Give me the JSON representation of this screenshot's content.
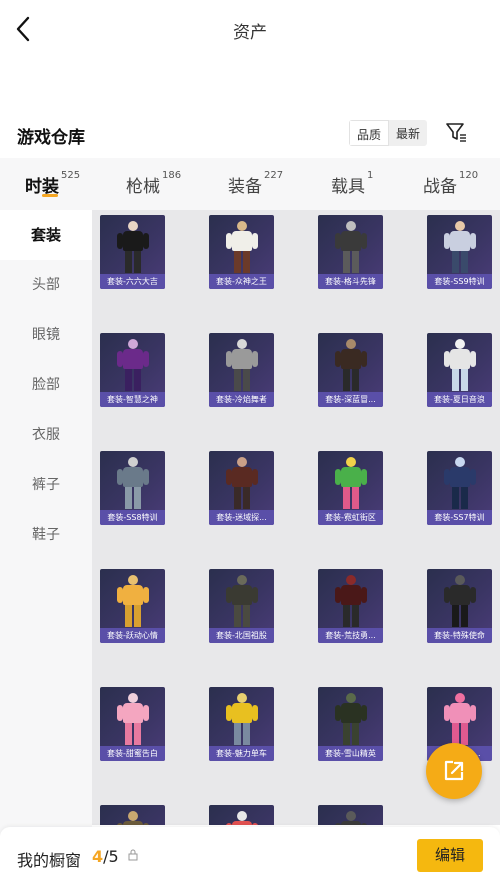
{
  "header": {
    "title": "资产"
  },
  "section": {
    "title": "游戏仓库",
    "sort_quality": "品质",
    "sort_latest": "最新"
  },
  "tabs": [
    {
      "label": "时装",
      "count": "525"
    },
    {
      "label": "枪械",
      "count": "186"
    },
    {
      "label": "装备",
      "count": "227"
    },
    {
      "label": "载具",
      "count": "1"
    },
    {
      "label": "战备",
      "count": "120"
    }
  ],
  "sidebar": [
    {
      "label": "套装"
    },
    {
      "label": "头部"
    },
    {
      "label": "眼镜"
    },
    {
      "label": "脸部"
    },
    {
      "label": "衣服"
    },
    {
      "label": "裤子"
    },
    {
      "label": "鞋子"
    }
  ],
  "items": [
    {
      "name": "套装-六六大吉"
    },
    {
      "name": "套装-众神之王"
    },
    {
      "name": "套装-格斗先锋"
    },
    {
      "name": "套装-SS9特训"
    },
    {
      "name": "套装-智慧之神"
    },
    {
      "name": "套装-冷焰舞者"
    },
    {
      "name": "套装-深蓝冒..."
    },
    {
      "name": "套装-夏日音浪"
    },
    {
      "name": "套装-SS8特训"
    },
    {
      "name": "套装-迷域探..."
    },
    {
      "name": "套装-霓虹街区"
    },
    {
      "name": "套装-SS7特训"
    },
    {
      "name": "套装-跃动心情"
    },
    {
      "name": "套装-北国祖股"
    },
    {
      "name": "套装-荒技勇..."
    },
    {
      "name": "套装-特殊使命"
    },
    {
      "name": "套装-甜蜜告白"
    },
    {
      "name": "套装-魅力单车"
    },
    {
      "name": "套装-雪山精英"
    },
    {
      "name": "套装-...小..."
    },
    {
      "name": ""
    },
    {
      "name": ""
    },
    {
      "name": ""
    }
  ],
  "bottom": {
    "label": "我的橱窗",
    "current": "4",
    "total": "/5",
    "edit_label": "编辑"
  },
  "colors": {
    "accent": "#f5a623",
    "caption_bg": "#5a4fa8",
    "edit_button": "#f5b80f"
  }
}
